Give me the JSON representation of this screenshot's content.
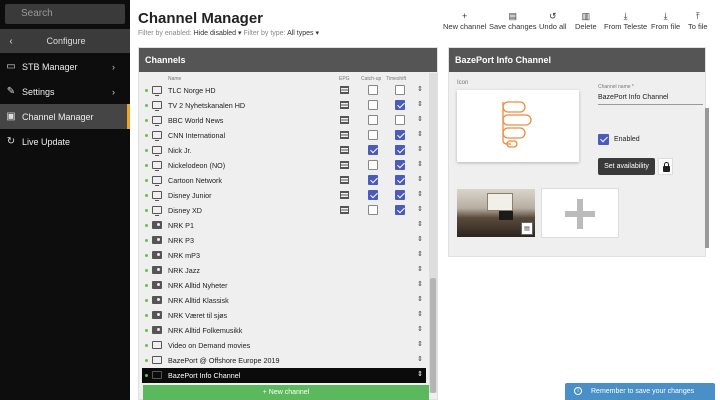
{
  "sidebar": {
    "search_placeholder": "Search",
    "configure": "Configure",
    "items": [
      {
        "label": "STB Manager",
        "icon": "monitor-icon"
      },
      {
        "label": "Settings",
        "icon": "wrench-icon"
      },
      {
        "label": "Channel Manager",
        "icon": "channel-icon"
      },
      {
        "label": "Live Update",
        "icon": "refresh-icon"
      }
    ]
  },
  "header": {
    "title": "Channel Manager",
    "filter_enabled_label": "Filter by enabled:",
    "filter_enabled_value": "Hide disabled",
    "filter_type_label": "Filter by type:",
    "filter_type_value": "All types"
  },
  "toolbar": {
    "new_channel": "New channel",
    "save_changes": "Save changes",
    "undo_all": "Undo all",
    "delete": "Delete",
    "from_teleste": "From Teleste",
    "from_file": "From file",
    "to_file": "To file"
  },
  "channels_panel": {
    "title": "Channels",
    "col_name": "Name",
    "col_epg": "EPG",
    "col_catchup": "Catch-up",
    "col_timeshift": "Timeshift",
    "new_channel_button": "+ New channel",
    "rows": [
      {
        "name": "TLC Norge HD",
        "type": "tv",
        "epg": true,
        "catchup": false,
        "timeshift": false
      },
      {
        "name": "TV 2 Nyhetskanalen HD",
        "type": "tv",
        "epg": true,
        "catchup": false,
        "timeshift": true
      },
      {
        "name": "BBC World News",
        "type": "tv",
        "epg": true,
        "catchup": false,
        "timeshift": false
      },
      {
        "name": "CNN International",
        "type": "tv",
        "epg": true,
        "catchup": false,
        "timeshift": true
      },
      {
        "name": "Nick Jr.",
        "type": "tv",
        "epg": true,
        "catchup": true,
        "timeshift": true
      },
      {
        "name": "Nickelodeon (NO)",
        "type": "tv",
        "epg": true,
        "catchup": false,
        "timeshift": true
      },
      {
        "name": "Cartoon Network",
        "type": "tv",
        "epg": true,
        "catchup": true,
        "timeshift": true
      },
      {
        "name": "Disney Junior",
        "type": "tv",
        "epg": true,
        "catchup": true,
        "timeshift": true
      },
      {
        "name": "Disney XD",
        "type": "tv",
        "epg": true,
        "catchup": false,
        "timeshift": true
      },
      {
        "name": "NRK P1",
        "type": "radio"
      },
      {
        "name": "NRK P3",
        "type": "radio"
      },
      {
        "name": "NRK mP3",
        "type": "radio"
      },
      {
        "name": "NRK Jazz",
        "type": "radio"
      },
      {
        "name": "NRK Alltid Nyheter",
        "type": "radio"
      },
      {
        "name": "NRK Alltid Klassisk",
        "type": "radio"
      },
      {
        "name": "NRK Været til sjøs",
        "type": "radio"
      },
      {
        "name": "NRK Alltid Folkemusikk",
        "type": "radio"
      },
      {
        "name": "Video on Demand movies",
        "type": "vod"
      },
      {
        "name": "BazePort @ Offshore Europe 2019",
        "type": "vod"
      },
      {
        "name": "BazePort Info Channel",
        "type": "info",
        "selected": true
      }
    ]
  },
  "info_panel": {
    "title": "BazePort Info Channel",
    "icon_label": "Icon",
    "channel_name_label": "Channel name *",
    "channel_name_value": "BazePort Info Channel",
    "enabled_label": "Enabled",
    "enabled": true,
    "set_availability": "Set availability",
    "logo_color": "#f08a3c"
  },
  "toast": {
    "message": "Remember to save your changes"
  },
  "colors": {
    "sidebar_bg": "#0d0d0d",
    "accent": "#f3a32a",
    "checkbox": "#4b5bbd",
    "green": "#5cb85c",
    "toast": "#4a90c8"
  }
}
